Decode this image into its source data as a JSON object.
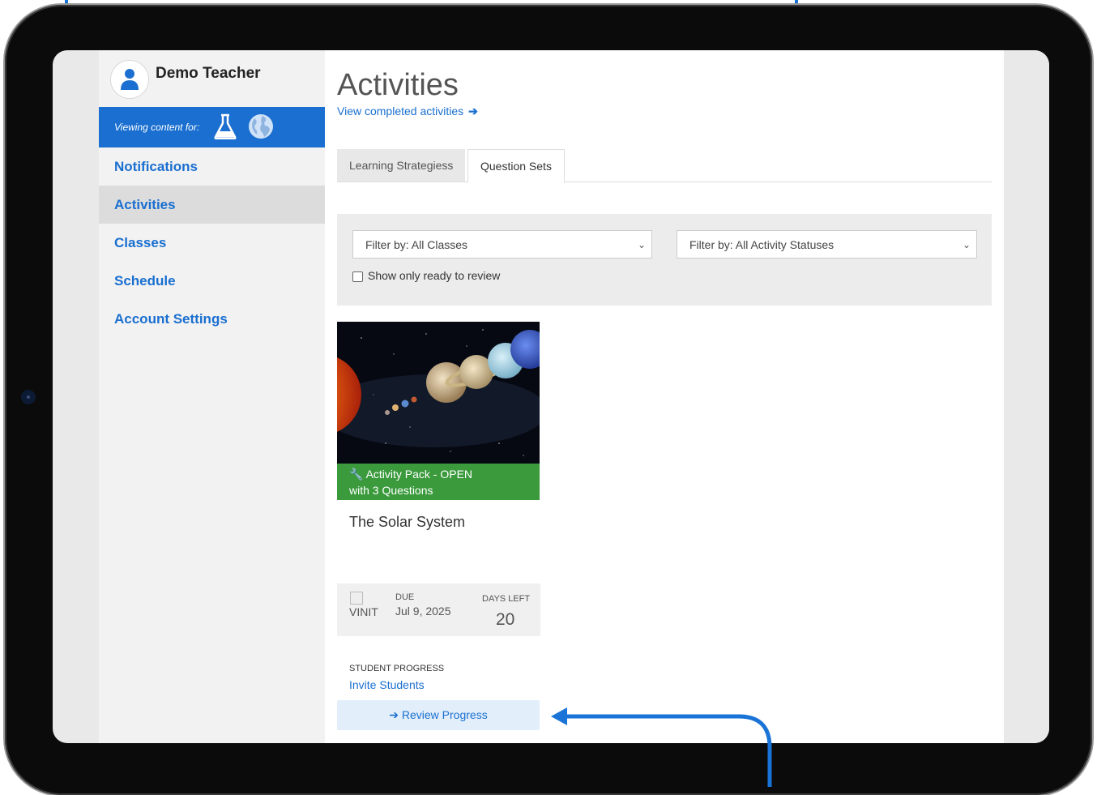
{
  "sidebar": {
    "user_name": "Demo Teacher",
    "viewing_label": "Viewing content for:",
    "items": [
      {
        "label": "Notifications"
      },
      {
        "label": "Activities"
      },
      {
        "label": "Classes"
      },
      {
        "label": "Schedule"
      },
      {
        "label": "Account Settings"
      }
    ],
    "active_index": 1
  },
  "main": {
    "title": "Activities",
    "completed_link": "View completed activities",
    "tabs": [
      {
        "label": "Learning Strategiess"
      },
      {
        "label": "Question Sets"
      }
    ],
    "active_tab": 1,
    "filters": {
      "classes": "Filter by: All Classes",
      "statuses": "Filter by: All Activity Statuses",
      "ready_checkbox_label": "Show only ready to review",
      "ready_checked": false
    },
    "card": {
      "status_line1": "Activity Pack - OPEN",
      "status_line2": "with 3 Questions",
      "title": "The Solar System",
      "class_name": "VINIT",
      "due_label": "DUE",
      "due_date": "Jul 9, 2025",
      "days_left_label": "DAYS LEFT",
      "days_left": "20",
      "progress_label": "STUDENT PROGRESS",
      "invite_link": "Invite Students",
      "review_button": "Review Progress"
    }
  },
  "colors": {
    "accent": "#1a6fd0",
    "status_green": "#3a9a3c",
    "annotation_arrow": "#1a73d6"
  }
}
